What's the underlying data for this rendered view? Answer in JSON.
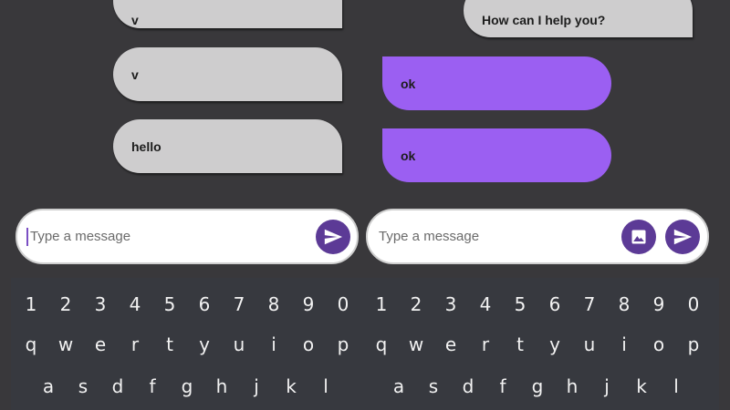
{
  "left_chat": {
    "messages": [
      {
        "text": "v",
        "type": "received"
      },
      {
        "text": "v",
        "type": "received"
      },
      {
        "text": "hello",
        "type": "received"
      }
    ],
    "input": {
      "placeholder": "Type a message"
    },
    "send_icon": "send-icon"
  },
  "right_chat": {
    "messages": [
      {
        "text": "How can I help you?",
        "type": "received"
      },
      {
        "text": "ok",
        "type": "sent"
      },
      {
        "text": "ok",
        "type": "sent"
      }
    ],
    "input": {
      "placeholder": "Type a message"
    },
    "image_icon": "image-icon",
    "send_icon": "send-icon"
  },
  "keyboard": {
    "rows": [
      [
        "1",
        "2",
        "3",
        "4",
        "5",
        "6",
        "7",
        "8",
        "9",
        "0"
      ],
      [
        "q",
        "w",
        "e",
        "r",
        "t",
        "y",
        "u",
        "i",
        "o",
        "p"
      ],
      [
        "a",
        "s",
        "d",
        "f",
        "g",
        "h",
        "j",
        "k",
        "l"
      ]
    ]
  },
  "colors": {
    "background": "#39383b",
    "received_bubble": "#cecdce",
    "sent_bubble": "#9b5ff2",
    "accent_button": "#5c3a96",
    "keyboard": "#37393f"
  }
}
